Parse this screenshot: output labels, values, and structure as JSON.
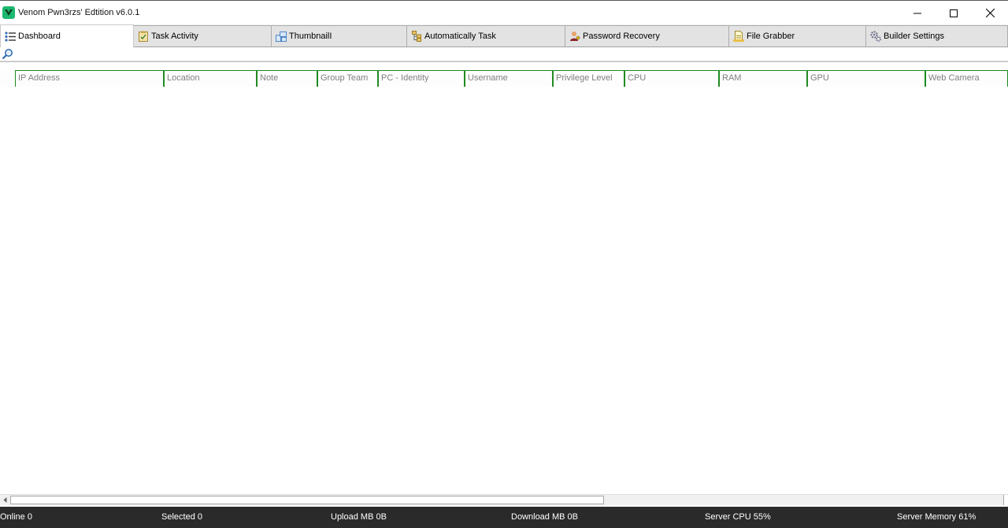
{
  "window": {
    "title": "Venom Pwn3rzs' Edtition v6.0.1",
    "controls": [
      "minimize-icon",
      "maximize-icon",
      "close-icon"
    ]
  },
  "tabs": [
    {
      "label": "Dashboard",
      "icon": "list-icon",
      "active": true
    },
    {
      "label": "Task Activity",
      "icon": "clipboard-icon",
      "active": false
    },
    {
      "label": "ThumbnailI",
      "icon": "thumbnail-icon",
      "active": false
    },
    {
      "label": "Automatically Task",
      "icon": "tree-icon",
      "active": false
    },
    {
      "label": "Password Recovery",
      "icon": "user-key-icon",
      "active": false
    },
    {
      "label": "File Grabber",
      "icon": "file-icon",
      "active": false
    },
    {
      "label": "Builder Settings",
      "icon": "gears-icon",
      "active": false
    }
  ],
  "search": {
    "icon": "search-icon"
  },
  "table": {
    "columns": [
      "IP Address",
      "Location",
      "Note",
      "Group Team",
      "PC - Identity",
      "Username",
      "Privilege Level",
      "CPU",
      "RAM",
      "GPU",
      "Web Camera"
    ],
    "rows": []
  },
  "status": {
    "online": "Online 0",
    "selected": "Selected 0",
    "upload": "Upload MB 0B",
    "download": "Download MB  0B",
    "server_cpu": "Server CPU 55%",
    "server_memory": "Server Memory 61%"
  },
  "colors": {
    "header_border": "#208a20",
    "statusbar": "#2a2a2a",
    "app_icon": "#1db870"
  }
}
